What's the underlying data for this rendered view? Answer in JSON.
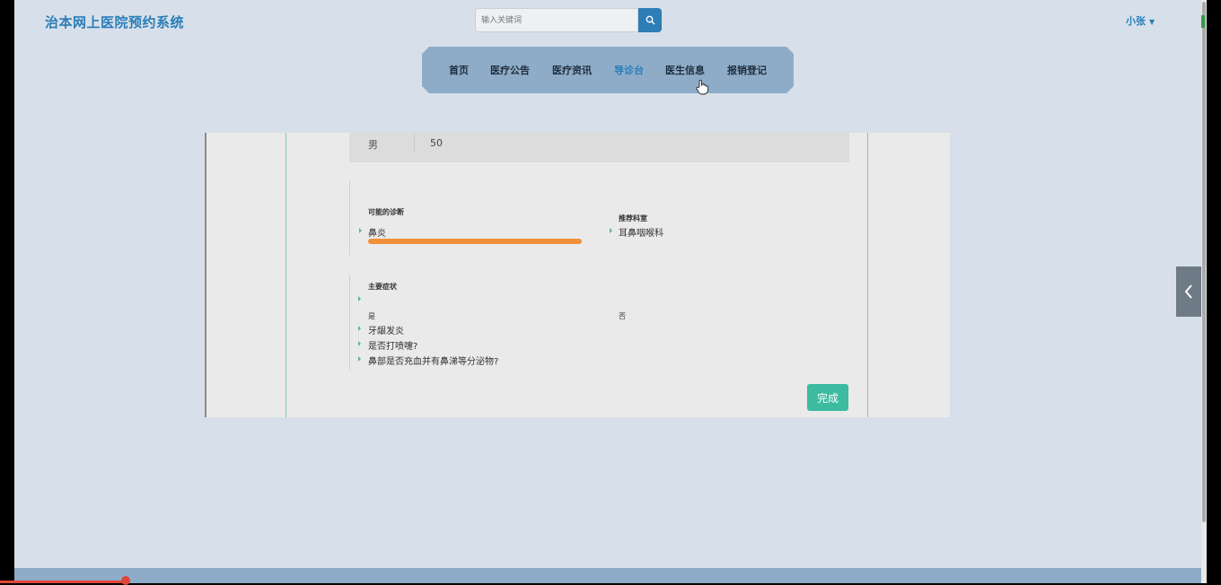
{
  "header": {
    "brand": "治本网上医院预约系统",
    "search_placeholder": "输入关键词",
    "user_name": "小张"
  },
  "nav": {
    "items": [
      "首页",
      "医疗公告",
      "医疗资讯",
      "导诊台",
      "医生信息",
      "报销登记"
    ],
    "active": "导诊台"
  },
  "patient": {
    "gender": "男",
    "age": "50"
  },
  "diagnosis": {
    "title": "可能的诊断",
    "item": "鼻炎",
    "probability": 1.0,
    "department_title": "推荐科室",
    "department": "耳鼻咽喉科"
  },
  "symptoms": {
    "title": "主要症状",
    "yes_label": "是",
    "no_label": "否",
    "items": [
      "牙龈发炎",
      "是否打喷嚏?",
      "鼻部是否充血并有鼻涕等分泌物?"
    ]
  },
  "actions": {
    "done": "完成"
  },
  "colors": {
    "accent": "#2b7db8",
    "nav_bg": "#8eacc8",
    "progress": "#f0913a",
    "done_button": "#3cbba0",
    "page_bg": "#d7e0ea"
  },
  "icons": {
    "search": "search-icon",
    "caret": "caret-down-icon",
    "side_toggle": "chevron-left-icon",
    "bullet": "triangle-right-icon"
  }
}
